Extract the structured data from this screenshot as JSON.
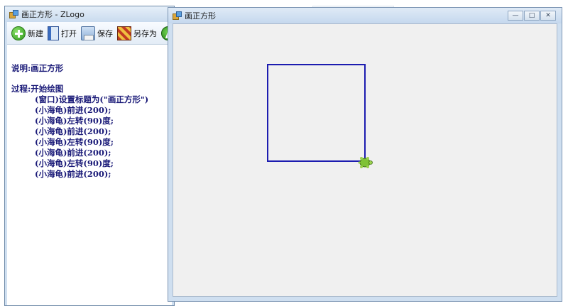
{
  "editor": {
    "title": "画正方形 - ZLogo",
    "toolbar": {
      "new_label": "新建",
      "open_label": "打开",
      "save_label": "保存",
      "saveas_label": "另存为"
    },
    "code": {
      "desc": "说明:画正方形",
      "proc": "过程:开始绘图",
      "steps": [
        "(窗口)设置标题为(\"画正方形\")",
        "(小海龟)前进(200);",
        "(小海龟)左转(90)度;",
        "(小海龟)前进(200);",
        "(小海龟)左转(90)度;",
        "(小海龟)前进(200);",
        "(小海龟)左转(90)度;",
        "(小海龟)前进(200);"
      ]
    }
  },
  "canvas": {
    "title": "画正方形",
    "minimize_icon": "minimize-icon",
    "maximize_icon": "maximize-icon",
    "close_icon": "close-icon",
    "line_color": "#1c1cb0",
    "turtle_color": "#7fc236"
  },
  "icons": {
    "new": "new-icon",
    "open": "open-icon",
    "save": "save-icon",
    "saveas": "saveas-icon",
    "run": "run-icon"
  }
}
